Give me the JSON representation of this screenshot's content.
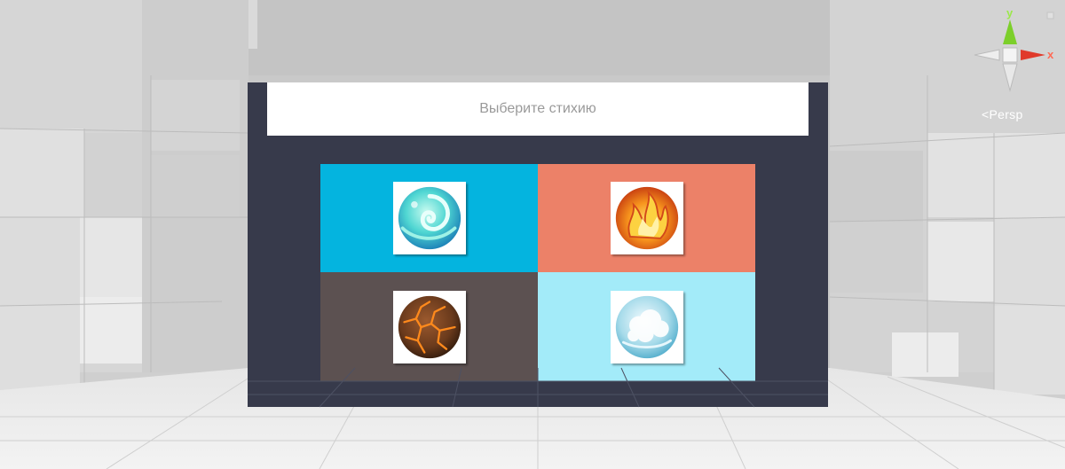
{
  "header": {
    "title": "Выберите стихию"
  },
  "elements": [
    {
      "id": "water",
      "icon": "water-orb-icon",
      "color": "#04b4df"
    },
    {
      "id": "fire",
      "icon": "fire-orb-icon",
      "color": "#ec8168"
    },
    {
      "id": "earth",
      "icon": "earth-orb-icon",
      "color": "#5c5151"
    },
    {
      "id": "air",
      "icon": "air-orb-icon",
      "color": "#a3ebf9"
    }
  ],
  "colors": {
    "panel": "#373a4b",
    "title_bg": "#ffffff",
    "title_text": "#9a9a9a"
  },
  "gizmo": {
    "y_label": "y",
    "x_label": "x",
    "projection_label": "Persp",
    "icon": "scene-orientation-gizmo-icon"
  }
}
